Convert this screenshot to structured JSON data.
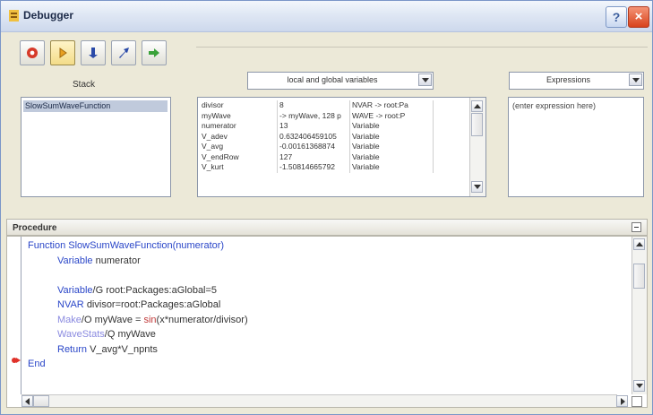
{
  "window": {
    "title": "Debugger",
    "help_label": "?",
    "close_label": "×"
  },
  "toolbar": {
    "buttons": [
      {
        "name": "stop-icon",
        "color": "#d63a2a"
      },
      {
        "name": "step-into-icon",
        "color": "#e8a020"
      },
      {
        "name": "step-icon",
        "color": "#2a4aa8"
      },
      {
        "name": "step-out-icon",
        "color": "#2a4aa8"
      },
      {
        "name": "go-icon",
        "color": "#3aa23a"
      }
    ]
  },
  "stack": {
    "label": "Stack",
    "items": [
      "SlowSumWaveFunction"
    ]
  },
  "variables": {
    "dropdown": "local and global variables",
    "rows": [
      [
        "divisor",
        "8",
        "NVAR -> root:Pa"
      ],
      [
        "myWave",
        "-> myWave, 128 p",
        "WAVE -> root:P"
      ],
      [
        "numerator",
        "13",
        "Variable"
      ],
      [
        "V_adev",
        "0.632406459105",
        "Variable"
      ],
      [
        "V_avg",
        "-0.00161368874",
        "Variable"
      ],
      [
        "V_endRow",
        "127",
        "Variable"
      ],
      [
        "V_kurt",
        "-1.50814665792",
        "Variable"
      ]
    ]
  },
  "expressions": {
    "dropdown": "Expressions",
    "placeholder": "(enter expression here)"
  },
  "procedure": {
    "title": "Procedure",
    "lines": [
      {
        "indent": 0,
        "tokens": [
          {
            "t": "Function ",
            "c": "kw"
          },
          {
            "t": "SlowSumWaveFunction(numerator)",
            "c": "kw"
          }
        ]
      },
      {
        "indent": 1,
        "tokens": [
          {
            "t": "Variable ",
            "c": "kw"
          },
          {
            "t": "numerator",
            "c": "plain"
          }
        ]
      },
      {
        "indent": 1,
        "tokens": []
      },
      {
        "indent": 1,
        "tokens": [
          {
            "t": "Variable",
            "c": "kw"
          },
          {
            "t": "/G root:Packages:aGlobal=5",
            "c": "plain"
          }
        ]
      },
      {
        "indent": 1,
        "tokens": [
          {
            "t": "NVAR ",
            "c": "kw"
          },
          {
            "t": "divisor=root:Packages:aGlobal",
            "c": "plain"
          }
        ]
      },
      {
        "indent": 1,
        "tokens": [
          {
            "t": "Make",
            "c": "fn"
          },
          {
            "t": "/O myWave = ",
            "c": "plain"
          },
          {
            "t": "sin",
            "c": "op"
          },
          {
            "t": "(x*numerator/divisor)",
            "c": "plain"
          }
        ]
      },
      {
        "indent": 1,
        "tokens": [
          {
            "t": "WaveStats",
            "c": "fn"
          },
          {
            "t": "/Q myWave",
            "c": "plain"
          }
        ]
      },
      {
        "indent": 1,
        "tokens": [
          {
            "t": "Return ",
            "c": "kw"
          },
          {
            "t": "V_avg*V_npnts",
            "c": "plain"
          }
        ]
      },
      {
        "indent": 0,
        "tokens": [
          {
            "t": "End",
            "c": "kw"
          }
        ]
      }
    ],
    "current_line": 7
  }
}
